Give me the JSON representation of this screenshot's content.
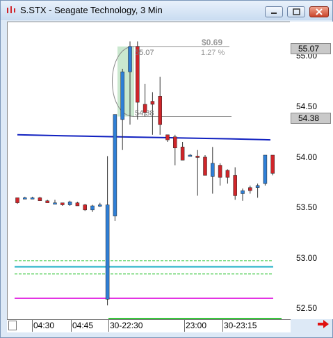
{
  "window": {
    "title": "S.STX - Seagate Technology, 3 Min"
  },
  "price_axis": {
    "labels": [
      "55.00",
      "54.50",
      "54.00",
      "53.50",
      "53.00",
      "52.50"
    ],
    "badges": [
      "55.07",
      "54.38"
    ]
  },
  "time_axis": {
    "labels": [
      "04:30",
      "04:45",
      "30-22:30",
      "23:00",
      "30-23:15"
    ]
  },
  "measure": {
    "change": "$0.69",
    "percent": "1.27 %",
    "high": "55.07",
    "low": "54.38"
  },
  "colors": {
    "up": "#2f7fd6",
    "down": "#d0252a",
    "ma": "#1020c0",
    "level_green": "#37c83c",
    "level_cyan": "#22b0c8",
    "level_magenta": "#e020e0"
  },
  "chart_data": {
    "type": "candlestick",
    "ylim": [
      52.43,
      55.3
    ],
    "candles": [
      {
        "o": 53.58,
        "h": 53.58,
        "l": 53.52,
        "c": 53.53
      },
      {
        "o": 53.58,
        "h": 53.59,
        "l": 53.57,
        "c": 53.58
      },
      {
        "o": 53.58,
        "h": 53.59,
        "l": 53.57,
        "c": 53.58
      },
      {
        "o": 53.58,
        "h": 53.59,
        "l": 53.57,
        "c": 53.55
      },
      {
        "o": 53.55,
        "h": 53.56,
        "l": 53.53,
        "c": 53.53
      },
      {
        "o": 53.53,
        "h": 53.56,
        "l": 53.52,
        "c": 53.53
      },
      {
        "o": 53.53,
        "h": 53.53,
        "l": 53.5,
        "c": 53.51
      },
      {
        "o": 53.51,
        "h": 53.55,
        "l": 53.5,
        "c": 53.54
      },
      {
        "o": 53.53,
        "h": 53.54,
        "l": 53.5,
        "c": 53.5
      },
      {
        "o": 53.51,
        "h": 53.52,
        "l": 53.45,
        "c": 53.46
      },
      {
        "o": 53.46,
        "h": 53.51,
        "l": 53.44,
        "c": 53.5
      },
      {
        "o": 53.5,
        "h": 53.53,
        "l": 53.49,
        "c": 53.51
      },
      {
        "o": 52.58,
        "h": 53.99,
        "l": 52.52,
        "c": 53.51
      },
      {
        "o": 53.4,
        "h": 54.4,
        "l": 53.35,
        "c": 54.4
      },
      {
        "o": 54.35,
        "h": 54.85,
        "l": 54.05,
        "c": 54.82
      },
      {
        "o": 54.82,
        "h": 55.12,
        "l": 54.3,
        "c": 55.07
      },
      {
        "o": 55.07,
        "h": 55.12,
        "l": 54.35,
        "c": 54.52
      },
      {
        "o": 54.5,
        "h": 54.7,
        "l": 54.38,
        "c": 54.42
      },
      {
        "o": 54.53,
        "h": 54.62,
        "l": 54.2,
        "c": 54.5
      },
      {
        "o": 54.58,
        "h": 54.77,
        "l": 54.2,
        "c": 54.3
      },
      {
        "o": 54.2,
        "h": 54.2,
        "l": 54.13,
        "c": 54.15
      },
      {
        "o": 54.18,
        "h": 54.2,
        "l": 53.9,
        "c": 54.07
      },
      {
        "o": 54.08,
        "h": 54.13,
        "l": 53.95,
        "c": 53.95
      },
      {
        "o": 54.0,
        "h": 54.01,
        "l": 53.99,
        "c": 54.0
      },
      {
        "o": 53.99,
        "h": 54.05,
        "l": 53.6,
        "c": 53.98
      },
      {
        "o": 53.98,
        "h": 54.0,
        "l": 53.8,
        "c": 53.8
      },
      {
        "o": 53.79,
        "h": 54.08,
        "l": 53.62,
        "c": 53.92
      },
      {
        "o": 53.9,
        "h": 53.92,
        "l": 53.7,
        "c": 53.78
      },
      {
        "o": 53.85,
        "h": 53.86,
        "l": 53.72,
        "c": 53.78
      },
      {
        "o": 53.8,
        "h": 53.88,
        "l": 53.56,
        "c": 53.6
      },
      {
        "o": 53.62,
        "h": 53.67,
        "l": 53.55,
        "c": 53.65
      },
      {
        "o": 53.68,
        "h": 53.7,
        "l": 53.62,
        "c": 53.65
      },
      {
        "o": 53.68,
        "h": 53.72,
        "l": 53.58,
        "c": 53.7
      },
      {
        "o": 53.72,
        "h": 54.0,
        "l": 53.7,
        "c": 54.0
      },
      {
        "o": 54.0,
        "h": 54.0,
        "l": 53.8,
        "c": 53.82
      }
    ],
    "moving_average": [
      54.2,
      54.19,
      54.18,
      54.17,
      54.16,
      54.15
    ],
    "levels": [
      {
        "value": 52.96,
        "color": "green",
        "style": "dashed"
      },
      {
        "value": 52.9,
        "color": "cyan",
        "style": "solid"
      },
      {
        "value": 52.83,
        "color": "green",
        "style": "dashed"
      },
      {
        "value": 52.59,
        "color": "magenta",
        "style": "solid"
      }
    ]
  }
}
